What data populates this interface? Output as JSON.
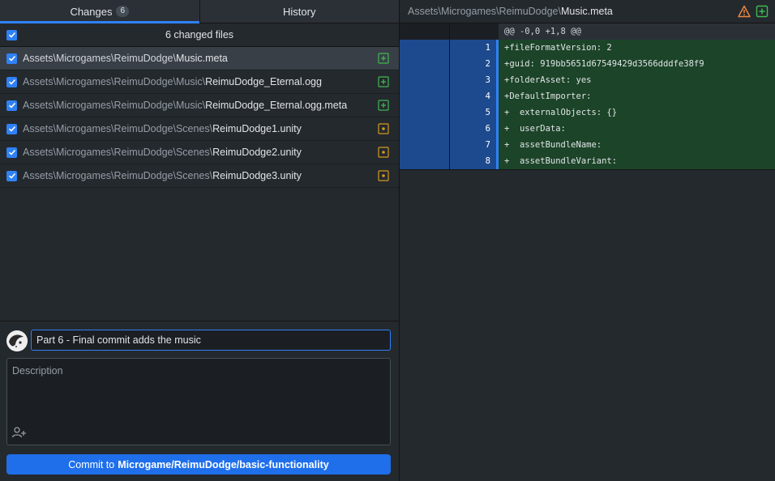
{
  "tabs": {
    "changes_label": "Changes",
    "changes_count": "6",
    "history_label": "History"
  },
  "changes_header": {
    "label": "6 changed files"
  },
  "files": [
    {
      "dir": "Assets\\Microgames\\ReimuDodge\\",
      "name": "Music.meta",
      "status": "added",
      "selected": true
    },
    {
      "dir": "Assets\\Microgames\\ReimuDodge\\Music\\",
      "name": "ReimuDodge_Eternal.ogg",
      "status": "added",
      "selected": false
    },
    {
      "dir": "Assets\\Microgames\\ReimuDodge\\Music\\",
      "name": "ReimuDodge_Eternal.ogg.meta",
      "status": "added",
      "selected": false
    },
    {
      "dir": "Assets\\Microgames\\ReimuDodge\\Scenes\\",
      "name": "ReimuDodge1.unity",
      "status": "modified",
      "selected": false
    },
    {
      "dir": "Assets\\Microgames\\ReimuDodge\\Scenes\\",
      "name": "ReimuDodge2.unity",
      "status": "modified",
      "selected": false
    },
    {
      "dir": "Assets\\Microgames\\ReimuDodge\\Scenes\\",
      "name": "ReimuDodge3.unity",
      "status": "modified",
      "selected": false
    }
  ],
  "commit": {
    "summary_value": "Part 6 - Final commit adds the music",
    "description_placeholder": "Description",
    "button_prefix": "Commit to",
    "button_branch": "Microgame/ReimuDodge/basic-functionality"
  },
  "diff": {
    "header_dir": "Assets\\Microgames\\ReimuDodge\\",
    "header_name": "Music.meta",
    "hunk": "@@ -0,0 +1,8 @@",
    "lines": [
      {
        "num": "1",
        "text": "+fileFormatVersion: 2"
      },
      {
        "num": "2",
        "text": "+guid: 919bb5651d67549429d3566dddfe38f9"
      },
      {
        "num": "3",
        "text": "+folderAsset: yes"
      },
      {
        "num": "4",
        "text": "+DefaultImporter:"
      },
      {
        "num": "5",
        "text": "+  externalObjects: {}"
      },
      {
        "num": "6",
        "text": "+  userData:"
      },
      {
        "num": "7",
        "text": "+  assetBundleName:"
      },
      {
        "num": "8",
        "text": "+  assetBundleVariant:"
      }
    ]
  },
  "colors": {
    "accent": "#2f81f7",
    "added_icon": "#3fb950",
    "modified_icon": "#d29922",
    "warning_icon": "#f0883e"
  },
  "icons": {
    "added": "diff-added-icon",
    "modified": "diff-modified-icon",
    "warning": "warning-icon",
    "coauthor": "add-coauthor-icon"
  }
}
